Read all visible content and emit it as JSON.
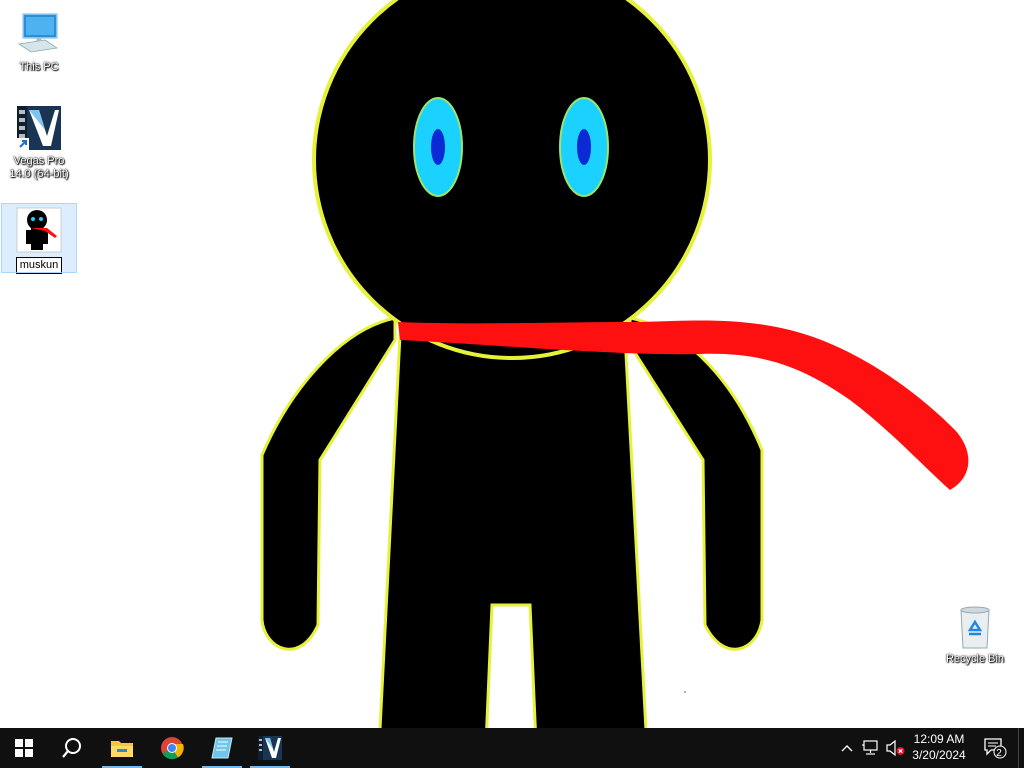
{
  "desktop": {
    "icons": [
      {
        "label": "This PC",
        "icon": "this-pc-icon"
      },
      {
        "label": "Vegas Pro 14.0 (64-bit)",
        "icon": "vegas-pro-icon"
      },
      {
        "label": "muskun",
        "icon": "muskun-image-icon",
        "renaming": true
      }
    ],
    "recycle_bin": {
      "label": "Recycle Bin",
      "icon": "recycle-bin-icon"
    }
  },
  "wallpaper": {
    "subject": "stick-figure-with-red-scarf",
    "body_color": "#000000",
    "outline_color": "#e6f23a",
    "eye_color": "#1ad1ff",
    "pupil_color": "#0a2ad6",
    "scarf_color": "#ff1010"
  },
  "taskbar": {
    "start_icon": "windows-start-icon",
    "search_icon": "search-icon",
    "pinned": [
      {
        "name": "file-explorer-icon",
        "running": true
      },
      {
        "name": "chrome-icon",
        "running": false
      },
      {
        "name": "notepad-icon",
        "running": true
      },
      {
        "name": "vegas-pro-taskbar-icon",
        "running": true
      }
    ],
    "tray": {
      "chevron": "chevron-up-icon",
      "network": "network-icon",
      "volume": "volume-muted-icon",
      "time": "12:09 AM",
      "date": "3/20/2024",
      "notifications_count": "2"
    }
  },
  "colors": {
    "taskbar_bg": "#101010",
    "running_indicator": "#76b9ed"
  }
}
